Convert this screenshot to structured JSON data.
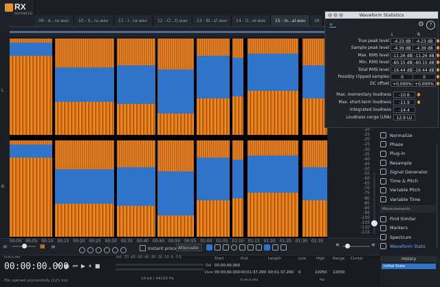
{
  "app": {
    "logo": "RX",
    "logo_sub": "ADVANCED"
  },
  "tabs": [
    {
      "label": "09 - A...ns.wav"
    },
    {
      "label": "10 - S...ru.wav"
    },
    {
      "label": "11 - I...ce.wav"
    },
    {
      "label": "12 - Cl...t).wav"
    },
    {
      "label": "13 - Bl...s).wav"
    },
    {
      "label": "14 - D...er.wav"
    },
    {
      "label": "15 - In...al.wav"
    },
    {
      "label": "16"
    }
  ],
  "channels": {
    "left": "L",
    "right": "R"
  },
  "ruler": [
    "00:00",
    "00:05",
    "00:10",
    "00:15",
    "00:20",
    "00:25",
    "00:30",
    "00:35",
    "00:40",
    "00:45",
    "00:50",
    "00:55",
    "01:00",
    "01:05",
    "01:10",
    "01:15",
    "01:20",
    "01:25",
    "01:30",
    "01:35"
  ],
  "db_axis": [
    "-5",
    "-10",
    "-15",
    "-20",
    "-25",
    "-30",
    "-35",
    "-40",
    "-45",
    "-50",
    "-55",
    "-60",
    "-65",
    "-70",
    "-75",
    "-80",
    "-85",
    "-90",
    "-95",
    "-100",
    "-105",
    "-110",
    "-115"
  ],
  "meter_bottom": "-inf",
  "modules": [
    {
      "label": "Normalize",
      "icon": "normalize-icon"
    },
    {
      "label": "Phase",
      "icon": "phase-icon"
    },
    {
      "label": "Plug-in",
      "icon": "plugin-icon"
    },
    {
      "label": "Resample",
      "icon": "resample-icon"
    },
    {
      "label": "Signal Generator",
      "icon": "signal-generator-icon"
    },
    {
      "label": "Time & Pitch",
      "icon": "time-pitch-icon"
    },
    {
      "label": "Variable Pitch",
      "icon": "variable-pitch-icon"
    },
    {
      "label": "Variable Time",
      "icon": "variable-time-icon"
    }
  ],
  "measurements_header": "Measurements",
  "measure_modules": [
    {
      "label": "Find Similar",
      "icon": "find-similar-icon"
    },
    {
      "label": "Markers",
      "icon": "markers-icon"
    },
    {
      "label": "Spectrum",
      "icon": "spectrum-icon"
    },
    {
      "label": "Waveform Stats",
      "icon": "waveform-stats-icon",
      "selected": true
    }
  ],
  "waveform_stats": {
    "title": "Waveform Statistics",
    "col_l": "L",
    "col_r": "R",
    "rows": [
      {
        "label": "True peak level",
        "l": "-4.23 dB",
        "r": "-4.23 dB"
      },
      {
        "label": "Sample peak level",
        "l": "-4.39 dB",
        "r": "-4.39 dB"
      },
      {
        "label": "Max. RMS level",
        "l": "-11.26 dB",
        "r": "-11.26 dB"
      },
      {
        "label": "Min. RMS level",
        "l": "-60.15 dB",
        "r": "-60.15 dB"
      },
      {
        "label": "Total RMS level",
        "l": "-16.44 dB",
        "r": "-16.44 dB"
      },
      {
        "label": "Possibly clipped samples",
        "l": "0",
        "r": "0"
      },
      {
        "label": "DC offset",
        "l": "+0.000%",
        "r": "+0.000%"
      }
    ],
    "loudness": [
      {
        "label": "Max. momentary loudness",
        "v": "-10.6 LUFS"
      },
      {
        "label": "Max. short-term loudness",
        "v": "-11.9 LUFS"
      },
      {
        "label": "Integrated loudness",
        "v": "-14.4 LUFS"
      },
      {
        "label": "Loudness range (LRA)",
        "v": "12.9 LU"
      }
    ]
  },
  "toolbar": {
    "instant_process": "Instant process",
    "attenuate": "Attenuate"
  },
  "transport": {
    "time_format": "h:m:s.ms",
    "timecode": "00:00:00.000",
    "status": "File opened successfully (121 ms)",
    "level_ticks": "-Inf. -70 -60 -50 -40 -30 -20 -10 -6 -3 0",
    "format": "16-bit | 44100 Hz"
  },
  "selection": {
    "start_h": "Start",
    "end_h": "End",
    "length_h": "Length",
    "low_h": "Low",
    "high_h": "High",
    "range_h": "Range",
    "cursor_h": "Cursor",
    "sel_label": "Sel",
    "view_label": "View",
    "sel_start": "00:00:00.000",
    "view_start": "00:00:00.000",
    "view_end": "00:01:37.280",
    "view_length": "00:01:37.280",
    "low": "0",
    "high": "22050",
    "range": "22050",
    "time_unit": "h:m:s.ms",
    "hz_unit": "Hz"
  },
  "history": {
    "header": "History",
    "item": "Initial State"
  }
}
